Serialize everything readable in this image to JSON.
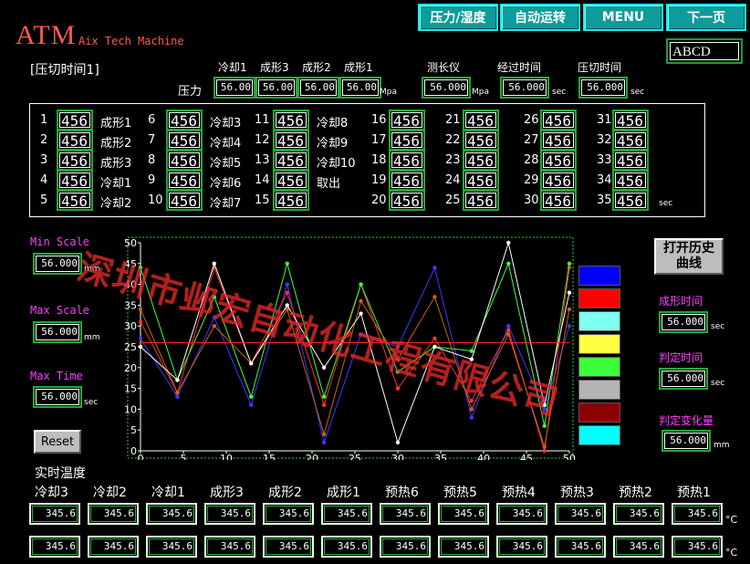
{
  "header": {
    "title": "ATM",
    "subtitle": "Aix Tech Machine",
    "nav": [
      {
        "label": "压力/湿度"
      },
      {
        "label": "自动运转"
      },
      {
        "label": "MENU"
      },
      {
        "label": "下一页"
      }
    ],
    "user_field": "ABCD"
  },
  "pressure_section": {
    "title": "[压切时间1]",
    "row_label": "压力",
    "columns": [
      {
        "label": "冷却1",
        "value": "56.00"
      },
      {
        "label": "成形3",
        "value": "56.00"
      },
      {
        "label": "成形2",
        "value": "56.00"
      },
      {
        "label": "成形1",
        "value": "56.00"
      }
    ],
    "unit_mpa": "Mpa",
    "measure": {
      "label": "测长仪",
      "value": "56.000",
      "unit": "Mpa"
    },
    "elapsed": {
      "label": "经过时间",
      "value": "56.000",
      "unit": "sec"
    },
    "cut_time": {
      "label": "压切时间",
      "value": "56.000",
      "unit": "sec"
    }
  },
  "time_table": {
    "unit": "sec",
    "rows": [
      [
        {
          "n": "1",
          "v": "456",
          "l": "成形1"
        },
        {
          "n": "6",
          "v": "456",
          "l": "冷却3"
        },
        {
          "n": "11",
          "v": "456",
          "l": "冷却8"
        },
        {
          "n": "16",
          "v": "456",
          "l": ""
        },
        {
          "n": "21",
          "v": "456",
          "l": ""
        },
        {
          "n": "26",
          "v": "456",
          "l": ""
        },
        {
          "n": "31",
          "v": "456",
          "l": ""
        }
      ],
      [
        {
          "n": "2",
          "v": "456",
          "l": "成形2"
        },
        {
          "n": "7",
          "v": "456",
          "l": "冷却4"
        },
        {
          "n": "12",
          "v": "456",
          "l": "冷却9"
        },
        {
          "n": "17",
          "v": "456",
          "l": ""
        },
        {
          "n": "22",
          "v": "456",
          "l": ""
        },
        {
          "n": "27",
          "v": "456",
          "l": ""
        },
        {
          "n": "32",
          "v": "456",
          "l": ""
        }
      ],
      [
        {
          "n": "3",
          "v": "456",
          "l": "成形3"
        },
        {
          "n": "8",
          "v": "456",
          "l": "冷却5"
        },
        {
          "n": "13",
          "v": "456",
          "l": "冷却10"
        },
        {
          "n": "18",
          "v": "456",
          "l": ""
        },
        {
          "n": "23",
          "v": "456",
          "l": ""
        },
        {
          "n": "28",
          "v": "456",
          "l": ""
        },
        {
          "n": "33",
          "v": "456",
          "l": ""
        }
      ],
      [
        {
          "n": "4",
          "v": "456",
          "l": "冷却1"
        },
        {
          "n": "9",
          "v": "456",
          "l": "冷却6"
        },
        {
          "n": "14",
          "v": "456",
          "l": "取出"
        },
        {
          "n": "19",
          "v": "456",
          "l": ""
        },
        {
          "n": "24",
          "v": "456",
          "l": ""
        },
        {
          "n": "29",
          "v": "456",
          "l": ""
        },
        {
          "n": "34",
          "v": "456",
          "l": ""
        }
      ],
      [
        {
          "n": "5",
          "v": "456",
          "l": "冷却2"
        },
        {
          "n": "10",
          "v": "456",
          "l": "冷却7"
        },
        {
          "n": "15",
          "v": "456",
          "l": ""
        },
        {
          "n": "20",
          "v": "456",
          "l": ""
        },
        {
          "n": "25",
          "v": "456",
          "l": ""
        },
        {
          "n": "30",
          "v": "456",
          "l": ""
        },
        {
          "n": "35",
          "v": "456",
          "l": ""
        }
      ]
    ]
  },
  "scales": {
    "min": {
      "label": "Min Scale",
      "value": "56.000",
      "unit": "mm"
    },
    "max": {
      "label": "Max Scale",
      "value": "56.000",
      "unit": "mm"
    },
    "time": {
      "label": "Max Time",
      "value": "56.000",
      "unit": "sec"
    },
    "reset_label": "Reset"
  },
  "right_panel": {
    "history_label": "打开历史\n曲线",
    "form_time": {
      "label": "成形时间",
      "value": "56.000",
      "unit": "sec"
    },
    "judge_time": {
      "label": "判定时间",
      "value": "56.000",
      "unit": "sec"
    },
    "judge_change": {
      "label": "判定变化量",
      "value": "56.000",
      "unit": "mm"
    }
  },
  "legend_colors": [
    "#0000ff",
    "#ff0000",
    "#7fffef",
    "#ffff40",
    "#3cff3c",
    "#b4b4b4",
    "#8b0000",
    "#00ffff"
  ],
  "watermark": "深圳市邺宏自动化工程有限公司",
  "temperature": {
    "title": "实时温度",
    "unit": "°C",
    "headers": [
      "冷却3",
      "冷却2",
      "冷却1",
      "成形3",
      "成形2",
      "成形1",
      "预热6",
      "预热5",
      "预热4",
      "预热3",
      "预热2",
      "预热1"
    ],
    "row1": [
      "345.6",
      "345.6",
      "345.6",
      "345.6",
      "345.6",
      "345.6",
      "345.6",
      "345.6",
      "345.6",
      "345.6",
      "345.6",
      "345.6"
    ],
    "row2": [
      "345.6",
      "345.6",
      "345.6",
      "345.6",
      "345.6",
      "345.6",
      "345.6",
      "345.6",
      "345.6",
      "345.6",
      "345.6",
      "345.6"
    ]
  },
  "chart_data": {
    "type": "line",
    "xlim": [
      0,
      50
    ],
    "ylim": [
      0,
      50
    ],
    "xticks": [
      "0",
      "5",
      "10",
      "15",
      "20",
      "25",
      "30",
      "35",
      "40",
      "45",
      "50"
    ],
    "yticks": [
      "0",
      "5",
      "10",
      "15",
      "20",
      "25",
      "30",
      "35",
      "40",
      "45",
      "50"
    ],
    "x": [
      0,
      4.3,
      8.6,
      12.9,
      17.1,
      21.4,
      25.7,
      30,
      34.3,
      38.6,
      42.9,
      47.1,
      50
    ],
    "reference_line": {
      "y": 26,
      "color": "#ff2020"
    },
    "grid": false,
    "series": [
      {
        "color": "#3a3aff",
        "values": [
          27,
          13,
          32,
          11,
          40,
          2,
          28,
          25,
          44,
          8,
          30,
          10,
          30
        ]
      },
      {
        "color": "#ff3030",
        "values": [
          31,
          14,
          44,
          21,
          38,
          11,
          40,
          15,
          27,
          12,
          29,
          0,
          44
        ]
      },
      {
        "color": "#40ff40",
        "values": [
          44,
          17,
          37,
          13,
          45,
          13,
          40,
          19,
          25,
          24,
          45,
          6,
          45
        ]
      },
      {
        "color": "#c86414",
        "values": [
          34,
          14,
          30,
          21,
          34,
          4,
          36,
          22,
          37,
          10,
          28,
          1,
          34
        ]
      },
      {
        "color": "#ffffff",
        "values": [
          25,
          17,
          45,
          21,
          35,
          20,
          33,
          2,
          25,
          22,
          50,
          11,
          38
        ]
      }
    ]
  }
}
